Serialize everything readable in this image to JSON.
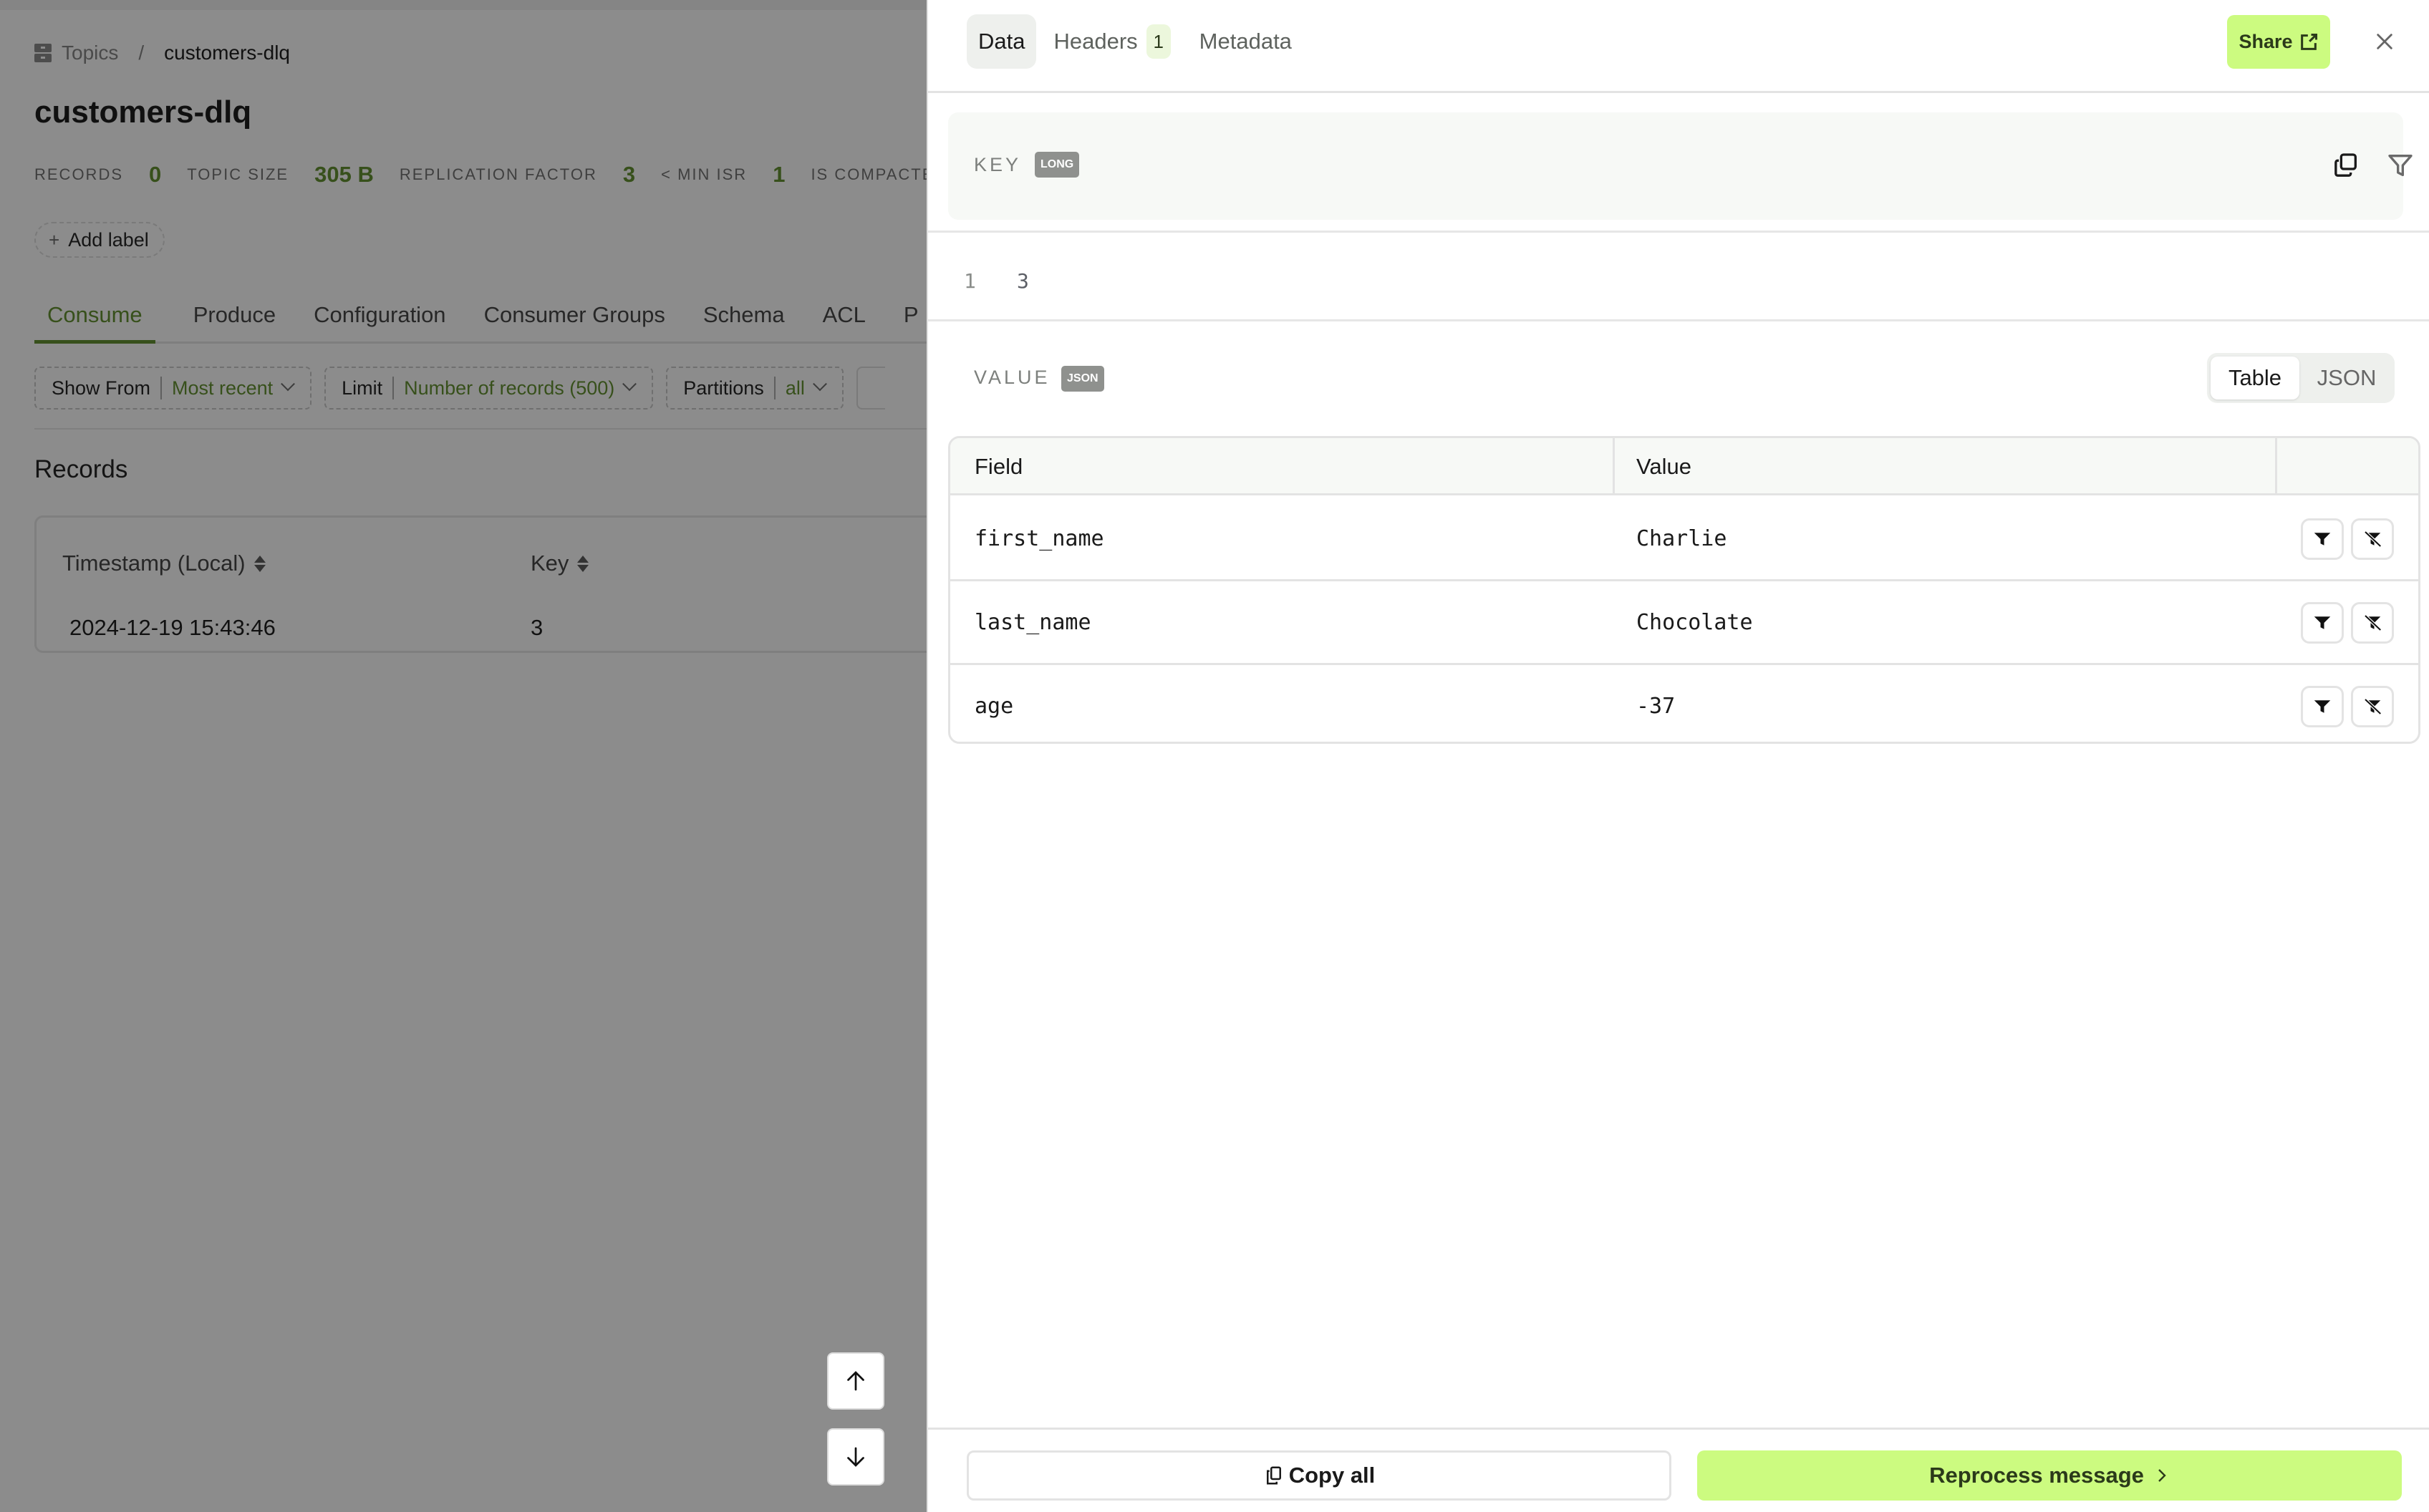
{
  "breadcrumb": {
    "icon": "topics-icon",
    "parent": "Topics",
    "separator": "/",
    "current": "customers-dlq"
  },
  "page_title": "customers-dlq",
  "stats": [
    {
      "label": "RECORDS",
      "value": "0"
    },
    {
      "label": "TOPIC SIZE",
      "value": "305 B"
    },
    {
      "label": "REPLICATION FACTOR",
      "value": "3"
    },
    {
      "label": "< MIN ISR",
      "value": "1"
    },
    {
      "label": "IS COMPACTED",
      "value": ""
    }
  ],
  "add_label": {
    "icon": "plus-icon",
    "text": "Add label"
  },
  "topic_tabs": [
    {
      "label": "Consume",
      "active": true
    },
    {
      "label": "Produce",
      "active": false
    },
    {
      "label": "Configuration",
      "active": false
    },
    {
      "label": "Consumer Groups",
      "active": false
    },
    {
      "label": "Schema",
      "active": false
    },
    {
      "label": "ACL",
      "active": false
    },
    {
      "label": "P",
      "active": false
    }
  ],
  "filters": [
    {
      "label": "Show From",
      "value": "Most recent"
    },
    {
      "label": "Limit",
      "value": "Number of records (500)"
    },
    {
      "label": "Partitions",
      "value": "all"
    }
  ],
  "records": {
    "title": "Records",
    "columns": [
      "Timestamp (Local)",
      "Key"
    ],
    "rows": [
      {
        "timestamp": "2024-12-19 15:43:46",
        "key": "3"
      }
    ]
  },
  "nav": {
    "up_icon": "arrow-up-icon",
    "down_icon": "arrow-down-icon"
  },
  "panel": {
    "tabs": [
      {
        "label": "Data",
        "active": true,
        "badge": null
      },
      {
        "label": "Headers",
        "active": false,
        "badge": "1"
      },
      {
        "label": "Metadata",
        "active": false,
        "badge": null
      }
    ],
    "share_label": "Share",
    "share_icon": "external-link-icon",
    "close_icon": "close-icon",
    "key": {
      "label": "KEY",
      "type": "LONG",
      "line_number": "1",
      "value": "3",
      "copy_icon": "copy-icon",
      "filter_icon": "filter-icon"
    },
    "value": {
      "label": "VALUE",
      "type": "JSON",
      "view_modes": [
        {
          "label": "Table",
          "active": true
        },
        {
          "label": "JSON",
          "active": false
        }
      ],
      "columns": [
        "Field",
        "Value",
        ""
      ],
      "rows": [
        {
          "field": "first_name",
          "value": "Charlie"
        },
        {
          "field": "last_name",
          "value": "Chocolate"
        },
        {
          "field": "age",
          "value": "-37"
        }
      ]
    },
    "footer": {
      "copy_all": "Copy all",
      "reprocess": "Reprocess message"
    }
  },
  "colors": {
    "accent_green": "#ccfb80",
    "dark_green_text": "#37501b",
    "overlay_gray": "#8c8c8c"
  }
}
